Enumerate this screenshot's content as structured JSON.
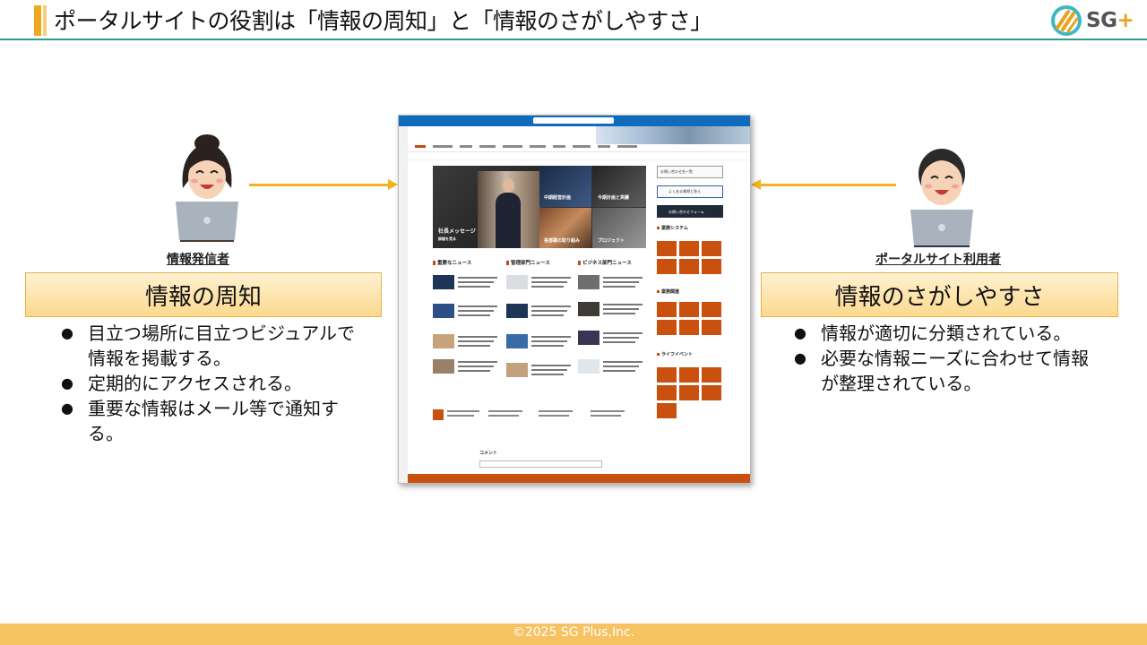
{
  "header": {
    "title": "ポータルサイトの役割は「情報の周知」と「情報のさがしやすさ」",
    "logo_text": "SG",
    "logo_plus": "+",
    "accent_color": "#f0a71e",
    "line_color": "#2f9c92"
  },
  "left": {
    "role": "情報発信者",
    "heading": "情報の周知",
    "bullets": [
      "目立つ場所に目立つビジュアルで情報を掲載する。",
      "定期的にアクセスされる。",
      "重要な情報はメール等で通知する。"
    ]
  },
  "right": {
    "role": "ポータルサイト利用者",
    "heading": "情報のさがしやすさ",
    "bullets": [
      "情報が適切に分類されている。",
      "必要な情報ニーズに合わせて情報が整理されている。"
    ]
  },
  "screenshot": {
    "hero_main": "社長メッセージ",
    "hero_sub": "詳細を見る",
    "tile_labels": [
      "中期経営計画",
      "今期計画と実績",
      "各部署の取り組み",
      "プロジェクト"
    ],
    "side_buttons": [
      "お問い合わせ先一覧",
      "よくある質問と答え",
      "お問い合わせフォーム"
    ],
    "side_sections": [
      "業務システム",
      "業務関連",
      "ライフイベント"
    ],
    "news_columns": [
      "重要なニュース",
      "管理部門ニュース",
      "ビジネス部門ニュース"
    ],
    "comment_label": "コメント",
    "brand_color": "#c9500f"
  },
  "footer": {
    "copyright": "©2025 SG Plus,Inc.",
    "color": "#f7c262"
  }
}
